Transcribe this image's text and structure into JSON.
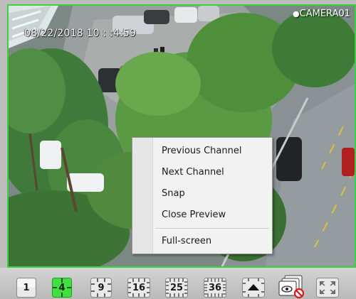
{
  "osd": {
    "timestamp": "08/22/2018 10 : :4:59",
    "camera_name": "CAMERA01"
  },
  "context_menu": {
    "items": [
      {
        "label": "Previous Channel"
      },
      {
        "label": "Next Channel"
      },
      {
        "label": "Snap"
      },
      {
        "label": "Close Preview"
      },
      {
        "label": "Full-screen"
      }
    ]
  },
  "toolbar": {
    "layout_buttons": [
      {
        "label": "1",
        "active": false
      },
      {
        "label": "4",
        "active": true
      },
      {
        "label": "9",
        "active": false
      },
      {
        "label": "16",
        "active": false
      },
      {
        "label": "25",
        "active": false
      },
      {
        "label": "36",
        "active": false
      }
    ],
    "icons": [
      "eject-icon",
      "hide-preview-icon",
      "fullscreen-icon"
    ]
  },
  "colors": {
    "active_border": "#3cd23c",
    "active_button": "#3fe03f"
  }
}
